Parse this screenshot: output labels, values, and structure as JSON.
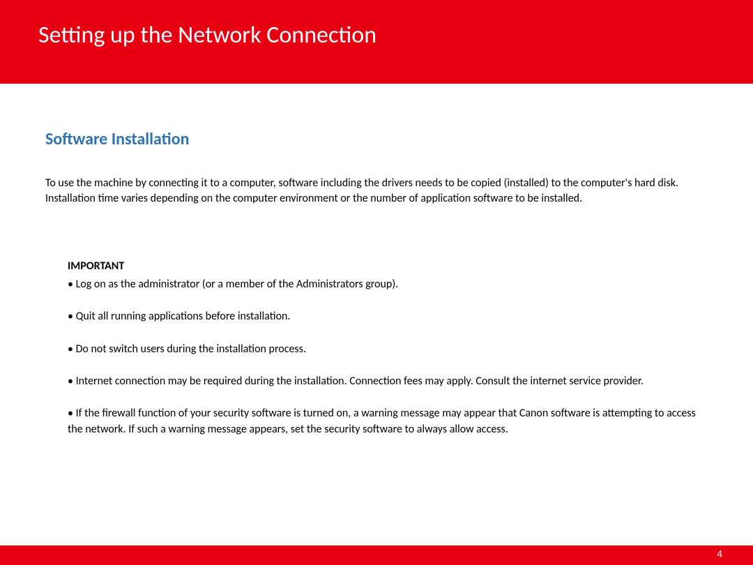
{
  "header": {
    "title": "Setting up the Network Connection"
  },
  "content": {
    "section_title": "Software Installation",
    "intro": "To use the machine by connecting it to a computer, software including the drivers needs to be copied (installed) to the computer's hard disk. Installation time varies depending on the computer environment or the number of application software to be installed.",
    "important_label": "IMPORTANT",
    "bullets": [
      "• Log on as the administrator (or a member of the Administrators group).",
      "• Quit all running applications before installation.",
      "• Do not switch users during the installation process.",
      "• Internet connection may be required during the installation. Connection fees may apply. Consult the internet service provider.",
      "• If the firewall function of your security software is turned on, a warning message may appear that Canon software is attempting to access the network. If such a warning message appears, set the security software to always allow access."
    ]
  },
  "footer": {
    "page_number": "4"
  }
}
